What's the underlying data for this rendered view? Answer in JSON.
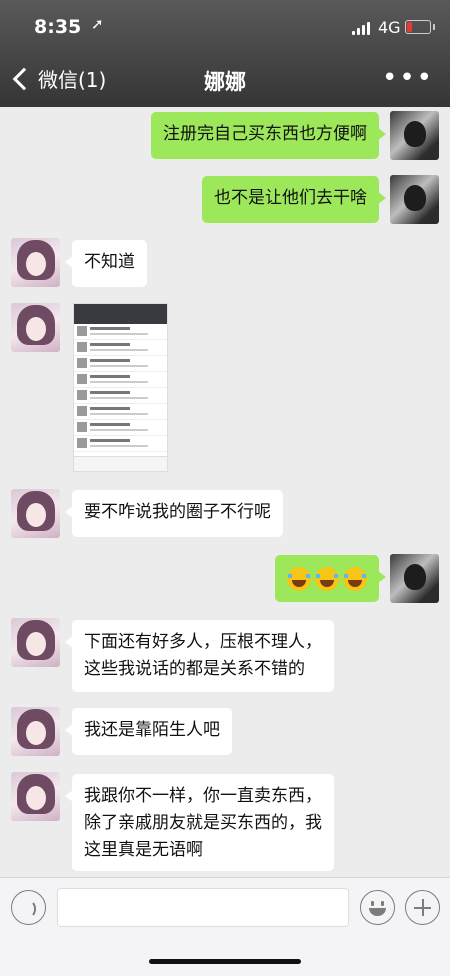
{
  "status": {
    "time": "8:35",
    "network": "4G"
  },
  "nav": {
    "back_label": "微信(1)",
    "title": "娜娜",
    "more": "•••"
  },
  "messages": [
    {
      "sender": "me",
      "text": "注册完自己买东西也方便啊"
    },
    {
      "sender": "me",
      "text": "也不是让他们去干啥"
    },
    {
      "sender": "her",
      "text": "不知道"
    },
    {
      "sender": "her",
      "type": "image",
      "description": "screenshot thumbnail"
    },
    {
      "sender": "her",
      "text": "要不咋说我的圈子不行呢"
    },
    {
      "sender": "me",
      "type": "emoji",
      "emoji_count": 3
    },
    {
      "sender": "her",
      "lines": [
        "下面还有好多人，压根不理人，",
        "这些我说话的都是关系不错的"
      ]
    },
    {
      "sender": "her",
      "text": "我还是靠陌生人吧"
    },
    {
      "sender": "her",
      "lines": [
        "我跟你不一样，你一直卖东西，",
        "除了亲戚朋友就是买东西的，我",
        "这里真是无语啊"
      ]
    }
  ],
  "input": {
    "placeholder": ""
  },
  "colors": {
    "my_bubble": "#9ce85a",
    "her_bubble": "#ffffff",
    "topbar": "#353535"
  }
}
